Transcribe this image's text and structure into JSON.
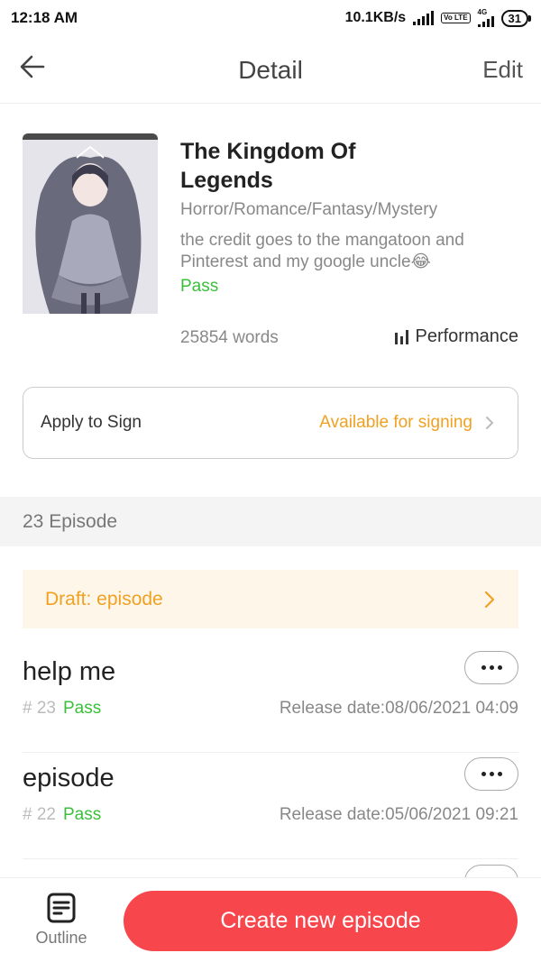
{
  "status_bar": {
    "time": "12:18 AM",
    "network_speed": "10.1KB/s",
    "volte": "Vo LTE",
    "network_type": "4G",
    "battery": "31"
  },
  "header": {
    "title": "Detail",
    "edit_label": "Edit",
    "back_icon": "arrow-left-icon"
  },
  "book": {
    "title": "The Kingdom Of Legends",
    "genres": "Horror/Romance/Fantasy/Mystery",
    "description": "the credit goes to the mangatoon and Pinterest and my google uncle😂",
    "status": "Pass",
    "word_count": "25854 words",
    "performance_label": "Performance"
  },
  "sign": {
    "label": "Apply to Sign",
    "status": "Available for signing"
  },
  "episodes": {
    "count_label": "23 Episode",
    "draft_label": "Draft: episode",
    "items": [
      {
        "title": "help me",
        "number": "# 23",
        "status": "Pass",
        "release": "Release date:08/06/2021 04:09"
      },
      {
        "title": "episode",
        "number": "# 22",
        "status": "Pass",
        "release": "Release date:05/06/2021 09:21"
      }
    ]
  },
  "bottom": {
    "outline_label": "Outline",
    "create_label": "Create new episode"
  },
  "colors": {
    "accent_red": "#f7464c",
    "pass_green": "#3bbf3b",
    "signing_orange": "#f0a122",
    "draft_bg": "#fff6ea"
  }
}
